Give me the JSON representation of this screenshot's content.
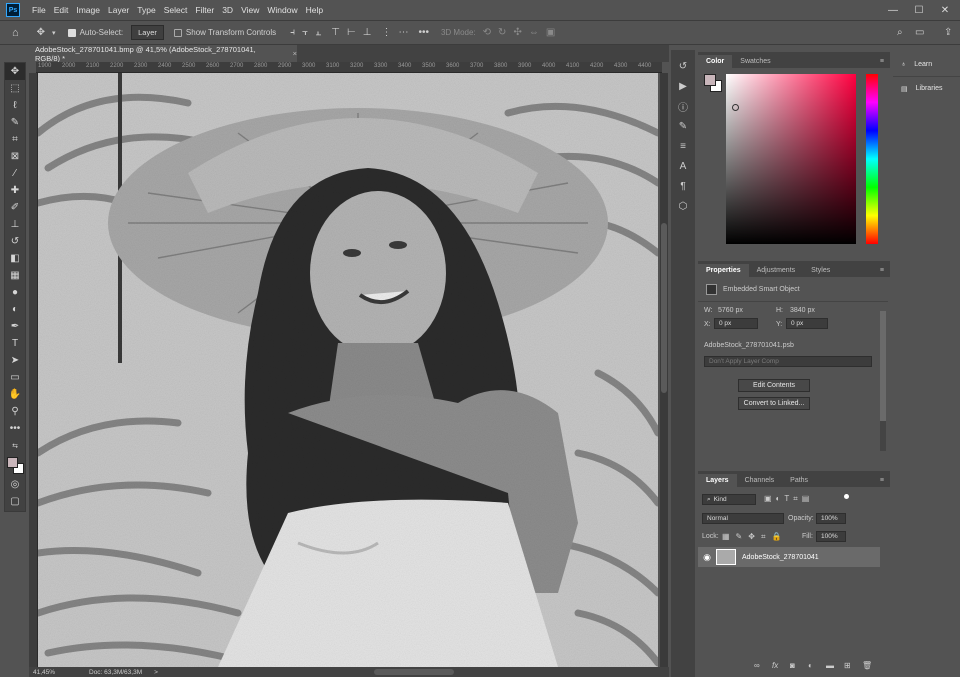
{
  "app": {
    "logo": "Ps"
  },
  "menu": [
    "File",
    "Edit",
    "Image",
    "Layer",
    "Type",
    "Select",
    "Filter",
    "3D",
    "View",
    "Window",
    "Help"
  ],
  "window_controls": {
    "minimize": "—",
    "maximize": "☐",
    "close": "✕"
  },
  "options_bar": {
    "auto_select_label": "Auto-Select:",
    "auto_select_target": "Layer",
    "show_transform_label": "Show Transform Controls",
    "mode_3d_label": "3D Mode:"
  },
  "document_tab": {
    "title": "AdobeStock_278701041.bmp @ 41,5% (AdobeStock_278701041, RGB/8) *",
    "close": "×"
  },
  "ruler_ticks": [
    "1900",
    "2000",
    "2100",
    "2200",
    "2300",
    "2400",
    "2500",
    "2600",
    "2700",
    "2800",
    "2900",
    "3000",
    "3100",
    "3200",
    "3300",
    "3400",
    "3500",
    "3600",
    "3700",
    "3800",
    "3900",
    "4000",
    "4100",
    "4200",
    "4300",
    "4400",
    "4500"
  ],
  "status": {
    "zoom": "41,45%",
    "doc": "Doc: 63,3M/63,3M",
    "arrow": ">"
  },
  "color_panel": {
    "tabs": [
      "Color",
      "Swatches"
    ],
    "active": 0
  },
  "properties_panel": {
    "tabs": [
      "Properties",
      "Adjustments",
      "Styles"
    ],
    "object_type": "Embedded Smart Object",
    "w_label": "W:",
    "w_value": "5760 px",
    "h_label": "H:",
    "h_value": "3840 px",
    "x_label": "X:",
    "x_value": "0 px",
    "y_label": "Y:",
    "y_value": "0 px",
    "filename": "AdobeStock_278701041.psb",
    "layer_comp": "Don't Apply Layer Comp",
    "edit_contents": "Edit Contents",
    "convert_linked": "Convert to Linked..."
  },
  "layers_panel": {
    "tabs": [
      "Layers",
      "Channels",
      "Paths"
    ],
    "filter_kind": "Kind",
    "blend_mode": "Normal",
    "opacity_label": "Opacity:",
    "opacity_value": "100%",
    "lock_label": "Lock:",
    "fill_label": "Fill:",
    "fill_value": "100%",
    "layer_name": "AdobeStock_278701041",
    "footer_icons": [
      "link-icon",
      "fx-icon",
      "mask-icon",
      "adjustment-icon",
      "group-icon",
      "new-layer-icon",
      "trash-icon"
    ],
    "footer_fx": "fx"
  },
  "right_panel": {
    "learn": "Learn",
    "libraries": "Libraries"
  },
  "colors": {
    "foreground": "#c9b6bb",
    "background": "#ffffff",
    "hue_marker": "#ff0040",
    "accent": "#31a8ff"
  }
}
